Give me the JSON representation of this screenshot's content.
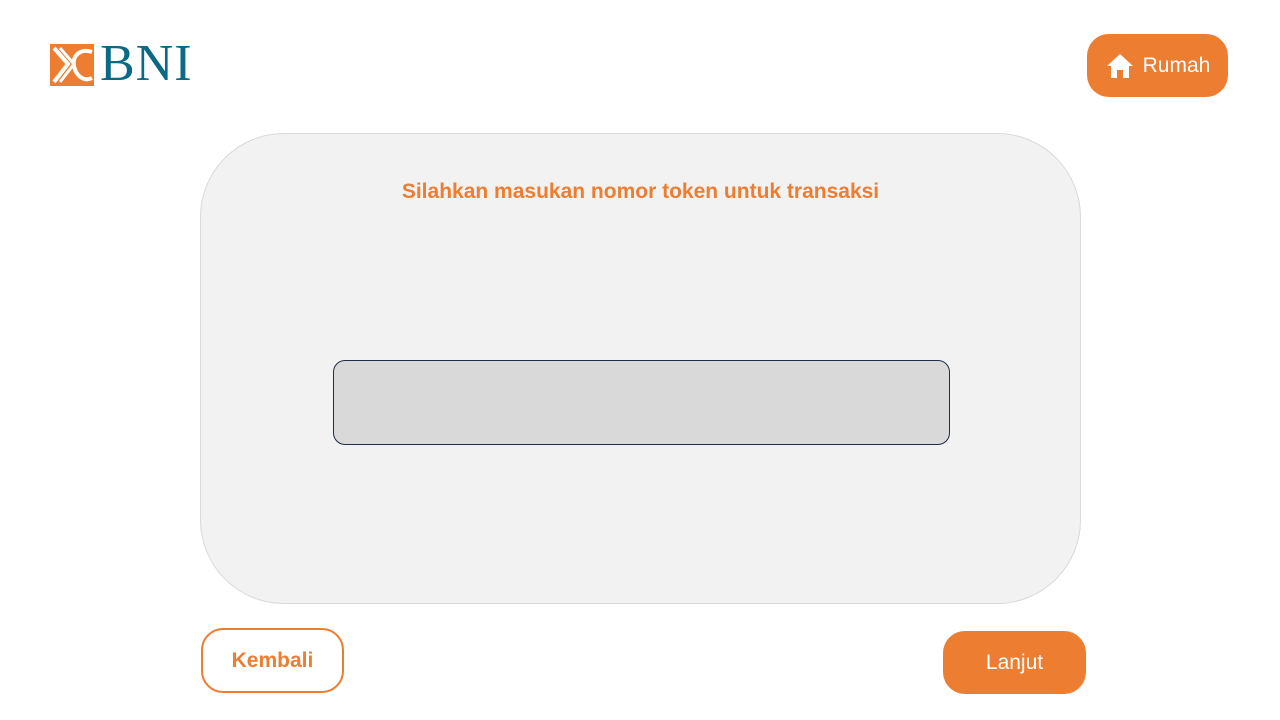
{
  "header": {
    "logo_text": "BNI",
    "home_button_label": "Rumah",
    "home_icon": "home-icon"
  },
  "panel": {
    "title": "Silahkan masukan nomor token untuk transaksi",
    "token_input": {
      "value": "",
      "placeholder": ""
    }
  },
  "footer": {
    "back_label": "Kembali",
    "next_label": "Lanjut"
  },
  "colors": {
    "accent": "#ed7d31",
    "brand_teal": "#0a6a86",
    "panel_bg": "#f2f2f2",
    "input_bg": "#d9d9d9",
    "input_border": "#1f2d46"
  }
}
